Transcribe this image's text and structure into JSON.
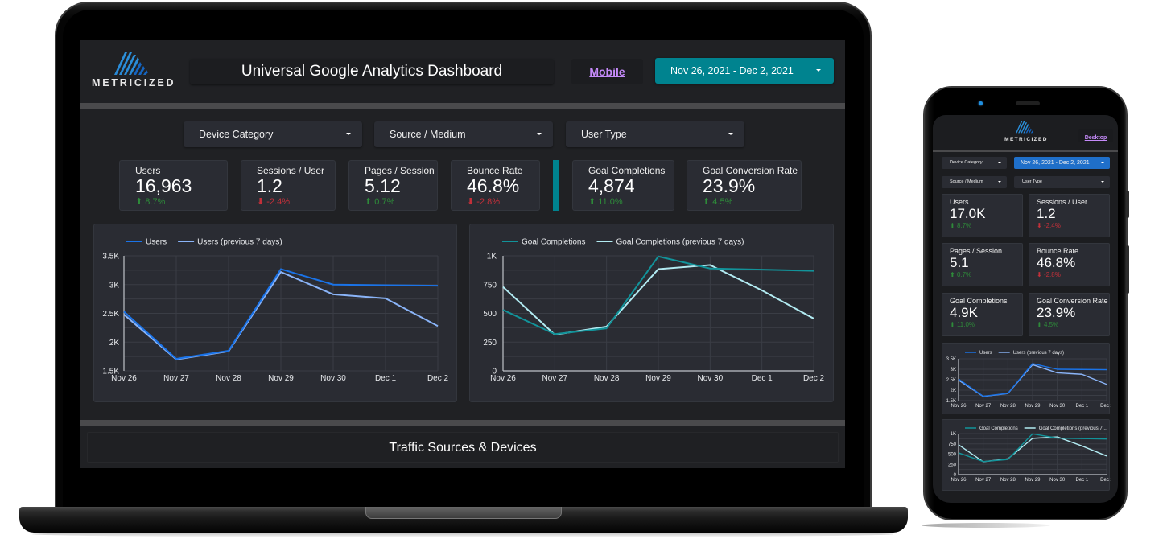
{
  "colors": {
    "accent_teal": "#00838f",
    "date_button_mobile": "#1f6fc9",
    "link_purple": "#c58af9",
    "positive": "#2e8b3a",
    "negative": "#c4303a",
    "users_line": "#1a73e8",
    "users_prev_line": "#8ab4f8",
    "goal_line": "#12939a",
    "goal_prev_line": "#b2ebf2"
  },
  "desktop": {
    "brand": "METRICIZED",
    "title": "Universal Google Analytics Dashboard",
    "view_toggle_link": "Mobile",
    "date_range": "Nov 26, 2021 - Dec 2, 2021",
    "filters": [
      {
        "label": "Device Category"
      },
      {
        "label": "Source / Medium"
      },
      {
        "label": "User Type"
      }
    ],
    "kpis": [
      {
        "label": "Users",
        "value": "16,963",
        "delta": "8.7%",
        "direction": "up"
      },
      {
        "label": "Sessions / User",
        "value": "1.2",
        "delta": "-2.4%",
        "direction": "down"
      },
      {
        "label": "Pages / Session",
        "value": "5.12",
        "delta": "0.7%",
        "direction": "up"
      },
      {
        "label": "Bounce Rate",
        "value": "46.8%",
        "delta": "-2.8%",
        "direction": "down"
      },
      {
        "label": "Goal Completions",
        "value": "4,874",
        "delta": "11.0%",
        "direction": "up"
      },
      {
        "label": "Goal Conversion Rate",
        "value": "23.9%",
        "delta": "4.5%",
        "direction": "up"
      }
    ],
    "section_title": "Traffic Sources & Devices"
  },
  "mobile": {
    "brand": "METRICIZED",
    "view_toggle_link": "Desktop",
    "date_range": "Nov 26, 2021 - Dec 2, 2021",
    "filters": [
      {
        "label": "Device Category"
      },
      {
        "label": "Source / Medium"
      },
      {
        "label": "User Type"
      }
    ],
    "kpis": [
      {
        "label": "Users",
        "value": "17.0K",
        "delta": "8.7%",
        "direction": "up"
      },
      {
        "label": "Sessions / User",
        "value": "1.2",
        "delta": "-2.4%",
        "direction": "down"
      },
      {
        "label": "Pages / Session",
        "value": "5.1",
        "delta": "0.7%",
        "direction": "up"
      },
      {
        "label": "Bounce Rate",
        "value": "46.8%",
        "delta": "-2.8%",
        "direction": "down"
      },
      {
        "label": "Goal Completions",
        "value": "4.9K",
        "delta": "11.0%",
        "direction": "up"
      },
      {
        "label": "Goal Conversion Rate",
        "value": "23.9%",
        "delta": "4.5%",
        "direction": "up"
      }
    ],
    "goal_legend_prev_truncated": "Goal Completions (previous 7..."
  },
  "chart_data": [
    {
      "type": "line",
      "id": "users",
      "title": "",
      "xlabel": "",
      "ylabel": "",
      "categories": [
        "Nov 26",
        "Nov 27",
        "Nov 28",
        "Nov 29",
        "Nov 30",
        "Dec 1",
        "Dec 2"
      ],
      "ylim": [
        1500,
        3500
      ],
      "yticks": [
        1500,
        2000,
        2500,
        3000,
        3500
      ],
      "ytick_labels": [
        "1.5K",
        "2K",
        "2.5K",
        "3K",
        "3.5K"
      ],
      "grid": true,
      "legend_position": "top-left",
      "series": [
        {
          "name": "Users",
          "color": "#1a73e8",
          "values": [
            2530,
            1710,
            1850,
            3270,
            3000,
            2990,
            2980
          ]
        },
        {
          "name": "Users (previous 7 days)",
          "color": "#8ab4f8",
          "values": [
            2480,
            1700,
            1840,
            3220,
            2830,
            2760,
            2280
          ]
        }
      ]
    },
    {
      "type": "line",
      "id": "goals",
      "title": "",
      "xlabel": "",
      "ylabel": "",
      "categories": [
        "Nov 26",
        "Nov 27",
        "Nov 28",
        "Nov 29",
        "Nov 30",
        "Dec 1",
        "Dec 2"
      ],
      "ylim": [
        0,
        1000
      ],
      "yticks": [
        0,
        250,
        500,
        750,
        1000
      ],
      "ytick_labels": [
        "0",
        "250",
        "500",
        "750",
        "1K"
      ],
      "grid": true,
      "legend_position": "top-left",
      "series": [
        {
          "name": "Goal Completions",
          "color": "#12939a",
          "values": [
            530,
            320,
            370,
            995,
            890,
            880,
            870
          ]
        },
        {
          "name": "Goal Completions (previous 7 days)",
          "color": "#b2ebf2",
          "values": [
            730,
            315,
            385,
            885,
            920,
            700,
            455
          ]
        }
      ]
    }
  ]
}
